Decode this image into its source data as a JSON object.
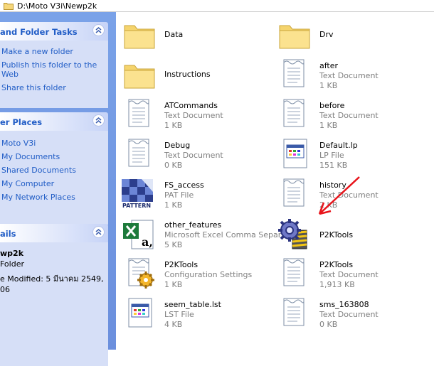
{
  "address_bar": {
    "path": "D:\\Moto V3i\\Newp2k"
  },
  "left_pane": {
    "tasks_panel": {
      "title": "and Folder Tasks",
      "items": [
        "Make a new folder",
        "Publish this folder to the Web",
        "Share this folder"
      ]
    },
    "places_panel": {
      "title": "er Places",
      "items": [
        "Moto V3i",
        "My Documents",
        "Shared Documents",
        "My Computer",
        "My Network Places"
      ]
    },
    "details_panel": {
      "title": "ails",
      "name": "wp2k",
      "type": "Folder",
      "modified": "e Modified: 5 มีนาคม 2549,",
      "time": "06"
    }
  },
  "files": [
    {
      "name": "Data",
      "icon": "folder-icon"
    },
    {
      "name": "Drv",
      "icon": "folder-icon"
    },
    {
      "name": "Instructions",
      "icon": "folder-icon"
    },
    {
      "name": "after",
      "type": "Text Document",
      "size": "1 KB",
      "icon": "text-document-icon"
    },
    {
      "name": "ATCommands",
      "type": "Text Document",
      "size": "1 KB",
      "icon": "text-document-icon"
    },
    {
      "name": "before",
      "type": "Text Document",
      "size": "1 KB",
      "icon": "text-document-icon"
    },
    {
      "name": "Debug",
      "type": "Text Document",
      "size": "0 KB",
      "icon": "text-document-icon"
    },
    {
      "name": "Default.lp",
      "type": "LP File",
      "size": "151 KB",
      "icon": "lp-file-icon"
    },
    {
      "name": "FS_access",
      "type": "PAT File",
      "size": "1 KB",
      "icon": "pattern-file-icon",
      "badge": "PATTERN"
    },
    {
      "name": "history",
      "type": "Text Document",
      "size": "2 KB",
      "icon": "text-document-icon"
    },
    {
      "name": "other_features",
      "type": "Microsoft Excel Comma Separ...",
      "size": "5 KB",
      "icon": "excel-csv-icon"
    },
    {
      "name": "P2KTools",
      "icon": "p2ktools-app-icon"
    },
    {
      "name": "P2KTools",
      "type": "Configuration Settings",
      "size": "1 KB",
      "icon": "config-settings-icon"
    },
    {
      "name": "P2KTools",
      "type": "Text Document",
      "size": "1,913 KB",
      "icon": "text-document-icon"
    },
    {
      "name": "seem_table.lst",
      "type": "LST File",
      "size": "4 KB",
      "icon": "lst-file-icon"
    },
    {
      "name": "sms_163808",
      "type": "Text Document",
      "size": "0 KB",
      "icon": "text-document-icon"
    }
  ],
  "colors": {
    "task_link": "#215dc6",
    "left_bg": "#6b8fdd",
    "panel_body": "#d6dff7",
    "subtext": "#7f7f7f",
    "annotation_arrow": "#e8141b"
  }
}
